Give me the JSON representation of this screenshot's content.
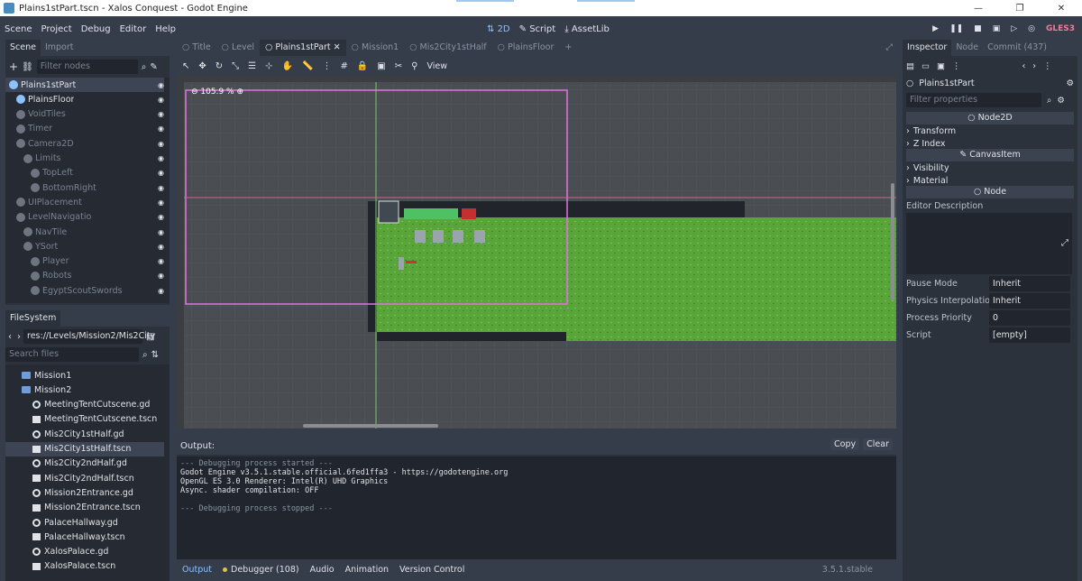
{
  "window": {
    "title": "Plains1stPart.tscn - Xalos Conquest - Godot Engine",
    "minimize": "—",
    "maximize": "❐",
    "close": "✕"
  },
  "menu": {
    "items": [
      "Scene",
      "Project",
      "Debug",
      "Editor",
      "Help"
    ],
    "workspaces": [
      "2D",
      "Script",
      "AssetLib"
    ],
    "renderer": "GLES3"
  },
  "scene_dock": {
    "tabs": [
      "Scene",
      "Import"
    ],
    "filter_placeholder": "Filter nodes",
    "nodes": [
      {
        "label": "Plains1stPart",
        "depth": 0,
        "dim": false
      },
      {
        "label": "PlainsFloor",
        "depth": 1,
        "dim": false
      },
      {
        "label": "VoidTiles",
        "depth": 1,
        "dim": true
      },
      {
        "label": "Timer",
        "depth": 1,
        "dim": true
      },
      {
        "label": "Camera2D",
        "depth": 1,
        "dim": true
      },
      {
        "label": "Limits",
        "depth": 2,
        "dim": true
      },
      {
        "label": "TopLeft",
        "depth": 3,
        "dim": true
      },
      {
        "label": "BottomRight",
        "depth": 3,
        "dim": true
      },
      {
        "label": "UIPlacement",
        "depth": 1,
        "dim": true
      },
      {
        "label": "LevelNavigatio",
        "depth": 1,
        "dim": true
      },
      {
        "label": "NavTile",
        "depth": 2,
        "dim": true
      },
      {
        "label": "YSort",
        "depth": 2,
        "dim": true
      },
      {
        "label": "Player",
        "depth": 3,
        "dim": true
      },
      {
        "label": "Robots",
        "depth": 3,
        "dim": true
      },
      {
        "label": "EgyptScoutSwords",
        "depth": 3,
        "dim": true
      }
    ]
  },
  "filesystem": {
    "tab": "FileSystem",
    "path": "res://Levels/Mission2/Mis2City",
    "search_placeholder": "Search files",
    "items": [
      {
        "label": "Mission1",
        "kind": "folder",
        "depth": 1
      },
      {
        "label": "Mission2",
        "kind": "folder",
        "depth": 1
      },
      {
        "label": "MeetingTentCutscene.gd",
        "kind": "script",
        "depth": 2
      },
      {
        "label": "MeetingTentCutscene.tscn",
        "kind": "scene",
        "depth": 2
      },
      {
        "label": "Mis2City1stHalf.gd",
        "kind": "script",
        "depth": 2
      },
      {
        "label": "Mis2City1stHalf.tscn",
        "kind": "scene",
        "depth": 2,
        "selected": true
      },
      {
        "label": "Mis2City2ndHalf.gd",
        "kind": "script",
        "depth": 2
      },
      {
        "label": "Mis2City2ndHalf.tscn",
        "kind": "scene",
        "depth": 2
      },
      {
        "label": "Mission2Entrance.gd",
        "kind": "script",
        "depth": 2
      },
      {
        "label": "Mission2Entrance.tscn",
        "kind": "scene",
        "depth": 2
      },
      {
        "label": "PalaceHallway.gd",
        "kind": "script",
        "depth": 2
      },
      {
        "label": "PalaceHallway.tscn",
        "kind": "scene",
        "depth": 2
      },
      {
        "label": "XalosPalace.gd",
        "kind": "script",
        "depth": 2
      },
      {
        "label": "XalosPalace.tscn",
        "kind": "scene",
        "depth": 2
      }
    ]
  },
  "scene_tabs": [
    "Title",
    "Level",
    "Plains1stPart",
    "Mission1",
    "Mis2City1stHalf",
    "PlainsFloor"
  ],
  "toolbar": {
    "view": "View"
  },
  "viewport": {
    "zoom": "105.9 %"
  },
  "output": {
    "title": "Output:",
    "copy": "Copy",
    "clear": "Clear",
    "lines": [
      "--- Debugging process started ---",
      "Godot Engine v3.5.1.stable.official.6fed1ffa3 - https://godotengine.org",
      "OpenGL ES 3.0 Renderer: Intel(R) UHD Graphics",
      "Async. shader compilation: OFF",
      "",
      "--- Debugging process stopped ---"
    ]
  },
  "bottom": {
    "tabs": [
      "Output",
      "Debugger (108)",
      "Audio",
      "Animation",
      "Version Control"
    ],
    "version": "3.5.1.stable"
  },
  "inspector": {
    "tabs": [
      "Inspector",
      "Node",
      "Commit (437)"
    ],
    "node": "Plains1stPart",
    "filter_placeholder": "Filter properties",
    "sections": [
      "Node2D",
      "CanvasItem",
      "Node"
    ],
    "groups": [
      "Transform",
      "Z Index",
      "Visibility",
      "Material"
    ],
    "editor_description": "Editor Description",
    "props": [
      {
        "key": "Pause Mode",
        "value": "Inherit"
      },
      {
        "key": "Physics Interpolation",
        "value": "Inherit"
      },
      {
        "key": "Process Priority",
        "value": "0"
      },
      {
        "key": "Script",
        "value": "[empty]"
      }
    ]
  }
}
